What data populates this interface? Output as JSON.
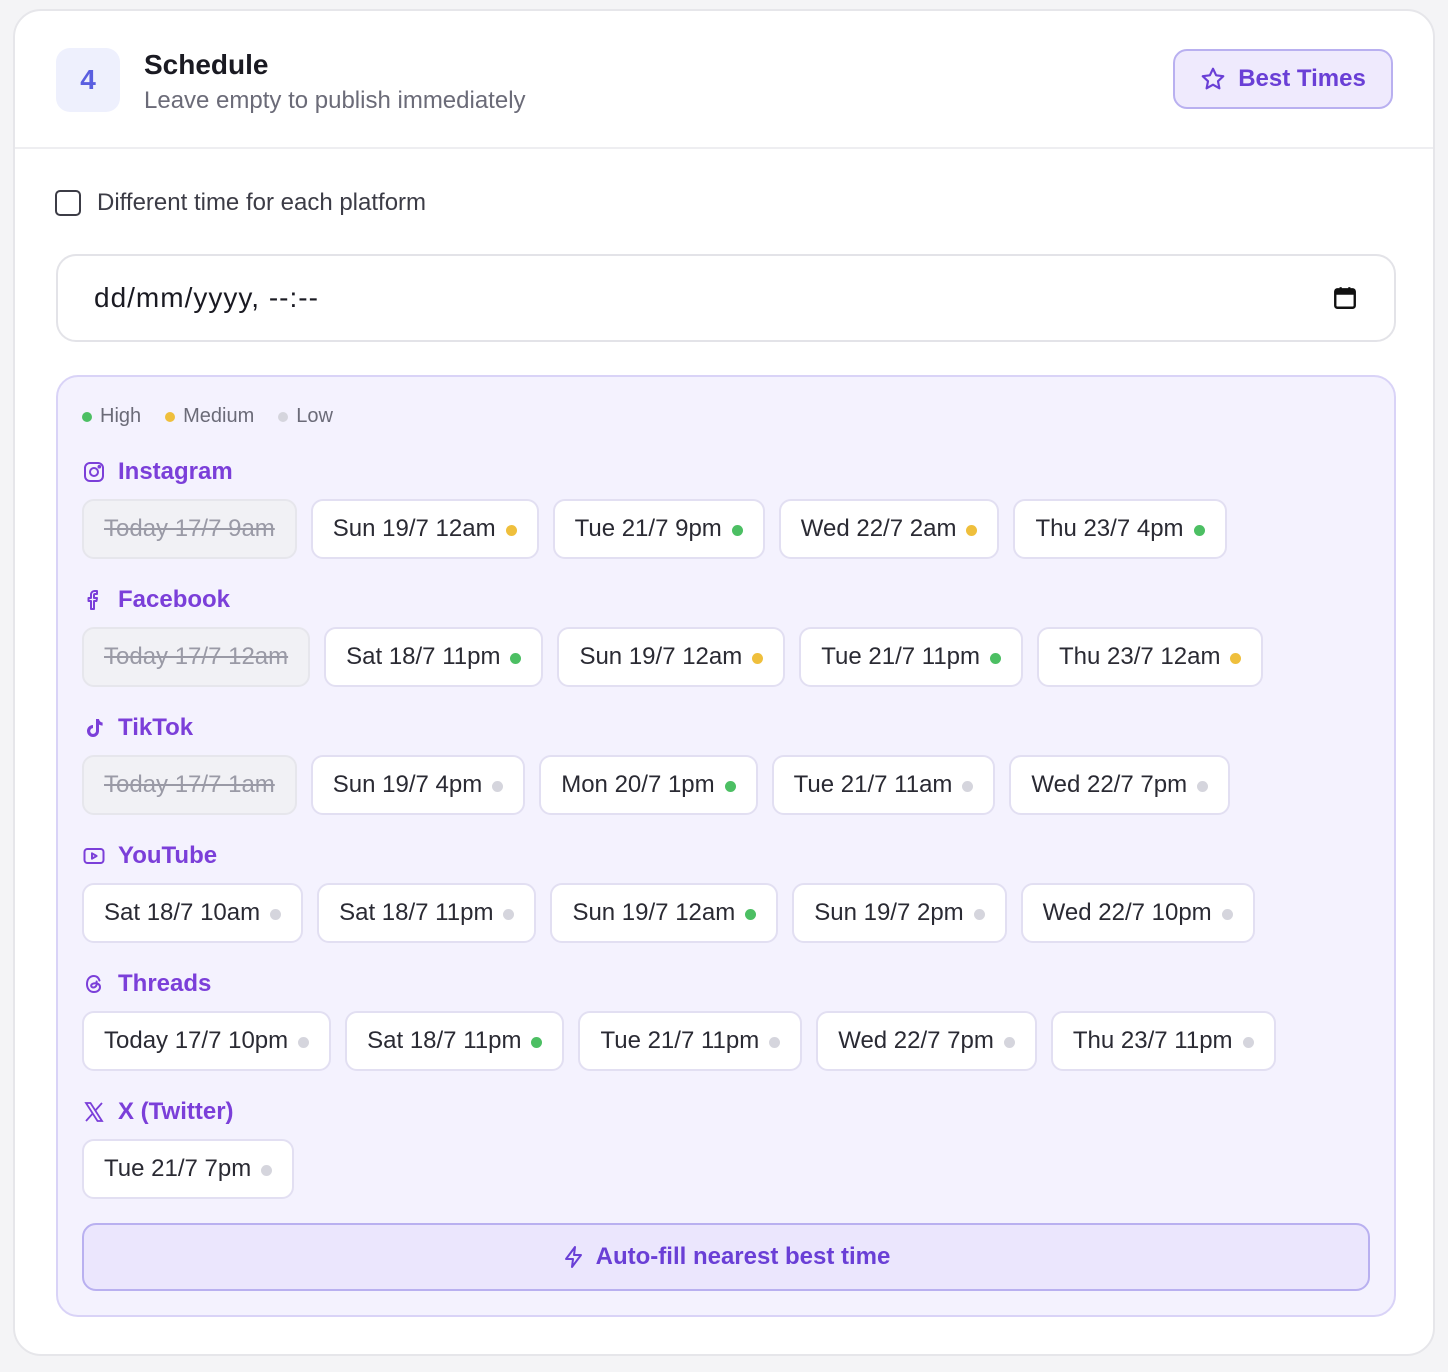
{
  "header": {
    "step": "4",
    "title": "Schedule",
    "subtitle": "Leave empty to publish immediately",
    "best_times_label": "Best Times"
  },
  "options": {
    "different_time_label": "Different time for each platform",
    "different_time_checked": false
  },
  "datetime": {
    "placeholder": "dd/mm/yyyy, --:--"
  },
  "legend": [
    {
      "label": "High",
      "color": "#4cbf63"
    },
    {
      "label": "Medium",
      "color": "#efbf3c"
    },
    {
      "label": "Low",
      "color": "#d5d5dd"
    }
  ],
  "colors": {
    "high": "#4cbf63",
    "medium": "#efbf3c",
    "low": "#d5d5dd",
    "accent": "#7b3fd9"
  },
  "platforms": [
    {
      "name": "Instagram",
      "icon": "instagram-icon",
      "slots": [
        {
          "label": "Today 17/7 9am",
          "past": true
        },
        {
          "label": "Sun 19/7 12am",
          "level": "medium"
        },
        {
          "label": "Tue 21/7 9pm",
          "level": "high"
        },
        {
          "label": "Wed 22/7 2am",
          "level": "medium"
        },
        {
          "label": "Thu 23/7 4pm",
          "level": "high"
        }
      ]
    },
    {
      "name": "Facebook",
      "icon": "facebook-icon",
      "slots": [
        {
          "label": "Today 17/7 12am",
          "past": true
        },
        {
          "label": "Sat 18/7 11pm",
          "level": "high"
        },
        {
          "label": "Sun 19/7 12am",
          "level": "medium"
        },
        {
          "label": "Tue 21/7 11pm",
          "level": "high"
        },
        {
          "label": "Thu 23/7 12am",
          "level": "medium"
        }
      ]
    },
    {
      "name": "TikTok",
      "icon": "tiktok-icon",
      "slots": [
        {
          "label": "Today 17/7 1am",
          "past": true
        },
        {
          "label": "Sun 19/7 4pm",
          "level": "low"
        },
        {
          "label": "Mon 20/7 1pm",
          "level": "high"
        },
        {
          "label": "Tue 21/7 11am",
          "level": "low"
        },
        {
          "label": "Wed 22/7 7pm",
          "level": "low"
        }
      ]
    },
    {
      "name": "YouTube",
      "icon": "youtube-icon",
      "slots": [
        {
          "label": "Sat 18/7 10am",
          "level": "low"
        },
        {
          "label": "Sat 18/7 11pm",
          "level": "low"
        },
        {
          "label": "Sun 19/7 12am",
          "level": "high"
        },
        {
          "label": "Sun 19/7 2pm",
          "level": "low"
        },
        {
          "label": "Wed 22/7 10pm",
          "level": "low"
        }
      ]
    },
    {
      "name": "Threads",
      "icon": "threads-icon",
      "slots": [
        {
          "label": "Today 17/7 10pm",
          "level": "low"
        },
        {
          "label": "Sat 18/7 11pm",
          "level": "high"
        },
        {
          "label": "Tue 21/7 11pm",
          "level": "low"
        },
        {
          "label": "Wed 22/7 7pm",
          "level": "low"
        },
        {
          "label": "Thu 23/7 11pm",
          "level": "low"
        }
      ]
    },
    {
      "name": "X (Twitter)",
      "icon": "x-twitter-icon",
      "slots": [
        {
          "label": "Tue 21/7 7pm",
          "level": "low"
        }
      ]
    }
  ],
  "autofill_label": "Auto-fill nearest best time"
}
